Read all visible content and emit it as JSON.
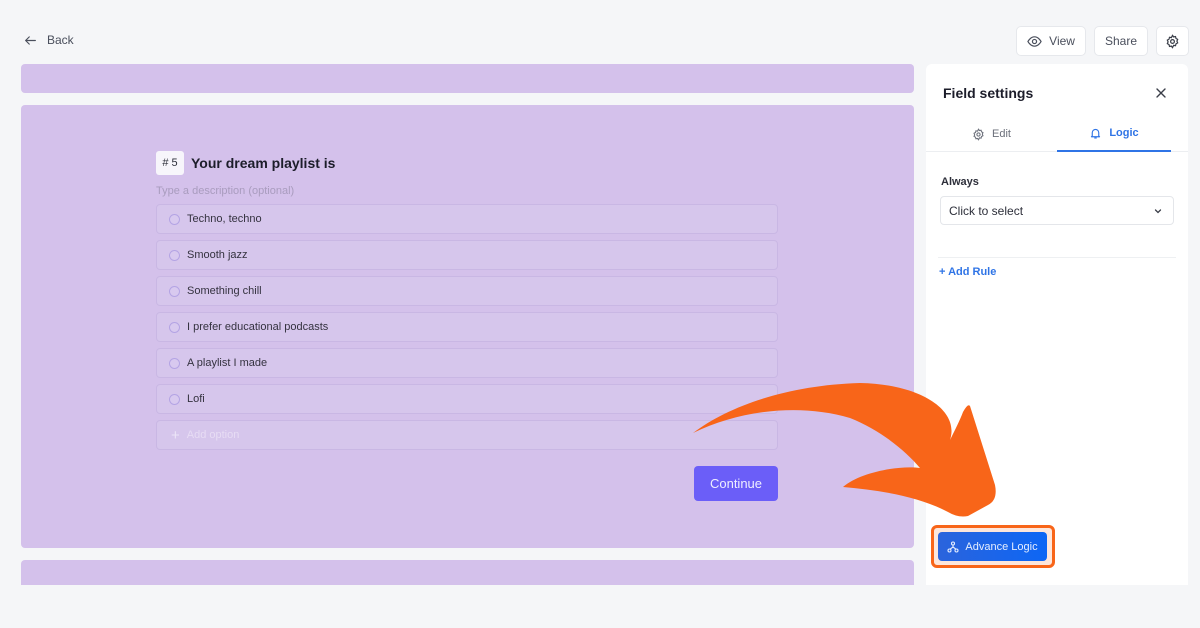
{
  "topbar": {
    "back_label": "Back",
    "view_label": "View",
    "share_label": "Share",
    "settings_icon": "gear-icon"
  },
  "question": {
    "number": "# 5",
    "title": "Your dream playlist is",
    "description_placeholder": "Type a description (optional)",
    "options": [
      "Techno, techno",
      "Smooth jazz",
      "Something chill",
      "I prefer educational podcasts",
      "A playlist I made",
      "Lofi"
    ],
    "add_option_label": "Add option",
    "continue_label": "Continue"
  },
  "panel": {
    "title": "Field settings",
    "tabs": [
      {
        "label": "Edit",
        "icon": "gear-icon",
        "active": false
      },
      {
        "label": "Logic",
        "icon": "bell-icon",
        "active": true
      }
    ],
    "always_label": "Always",
    "select_value": "Click to select",
    "add_rule_label": "+ Add Rule",
    "advance_logic_label": "Advance Logic"
  },
  "colors": {
    "accent": "#2f74e6",
    "form_background": "#d4c1eb",
    "continue_button": "#6b5ef8",
    "highlight": "#f86519"
  }
}
